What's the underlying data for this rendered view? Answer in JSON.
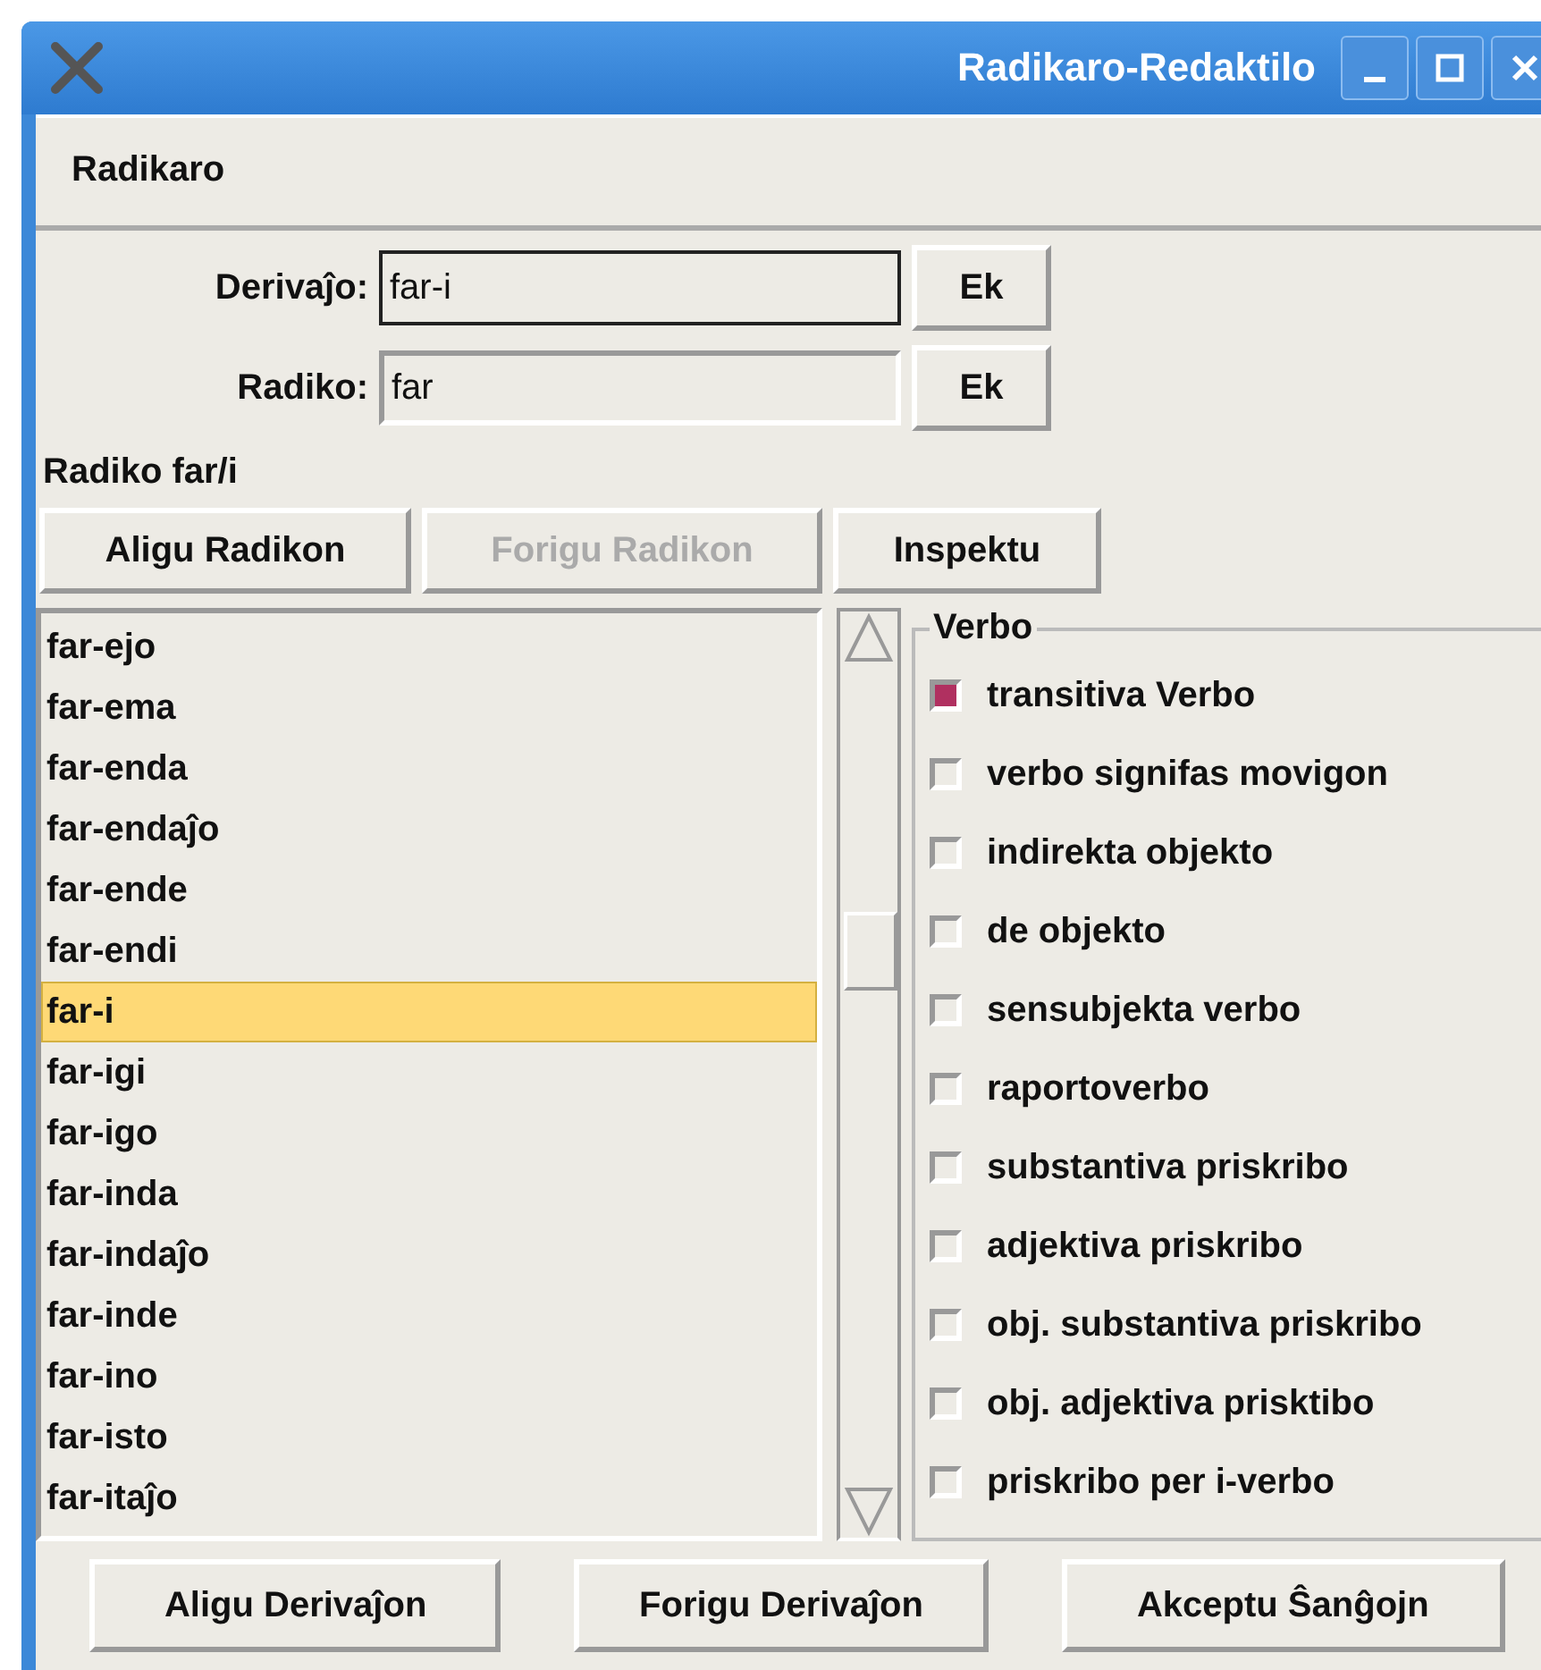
{
  "window": {
    "title": "Radikaro-Redaktilo"
  },
  "menu": [
    "Radikaro"
  ],
  "fields": [
    {
      "label": "Derivaĵo:",
      "value": "far-i",
      "focused": true,
      "button": "Ek"
    },
    {
      "label": "Radiko:",
      "value": "far",
      "focused": false,
      "button": "Ek"
    }
  ],
  "root_label": "Radiko far/i",
  "root_buttons": [
    {
      "label": "Aligu Radikon",
      "disabled": false
    },
    {
      "label": "Forigu Radikon",
      "disabled": true
    },
    {
      "label": "Inspektu",
      "disabled": false
    }
  ],
  "derivations": [
    {
      "text": "far-ejo",
      "selected": false
    },
    {
      "text": "far-ema",
      "selected": false
    },
    {
      "text": "far-enda",
      "selected": false
    },
    {
      "text": "far-endaĵo",
      "selected": false
    },
    {
      "text": "far-ende",
      "selected": false
    },
    {
      "text": "far-endi",
      "selected": false
    },
    {
      "text": "far-i",
      "selected": true
    },
    {
      "text": "far-igi",
      "selected": false
    },
    {
      "text": "far-igo",
      "selected": false
    },
    {
      "text": "far-inda",
      "selected": false
    },
    {
      "text": "far-indaĵo",
      "selected": false
    },
    {
      "text": "far-inde",
      "selected": false
    },
    {
      "text": "far-ino",
      "selected": false
    },
    {
      "text": "far-isto",
      "selected": false
    },
    {
      "text": "far-itaĵo",
      "selected": false
    }
  ],
  "verb_group": {
    "title": "Verbo",
    "options": [
      {
        "label": "transitiva Verbo",
        "checked": true
      },
      {
        "label": "verbo signifas movigon",
        "checked": false
      },
      {
        "label": "indirekta objekto",
        "checked": false
      },
      {
        "label": "de objekto",
        "checked": false
      },
      {
        "label": "sensubjekta verbo",
        "checked": false
      },
      {
        "label": "raportoverbo",
        "checked": false
      },
      {
        "label": "substantiva priskribo",
        "checked": false
      },
      {
        "label": "adjektiva priskribo",
        "checked": false
      },
      {
        "label": "obj. substantiva priskribo",
        "checked": false
      },
      {
        "label": "obj. adjektiva prisktibo",
        "checked": false
      },
      {
        "label": "priskribo per i-verbo",
        "checked": false
      }
    ]
  },
  "bottom_buttons": [
    "Aligu Derivaĵon",
    "Forigu Derivaĵon",
    "Akceptu Ŝanĝojn"
  ]
}
